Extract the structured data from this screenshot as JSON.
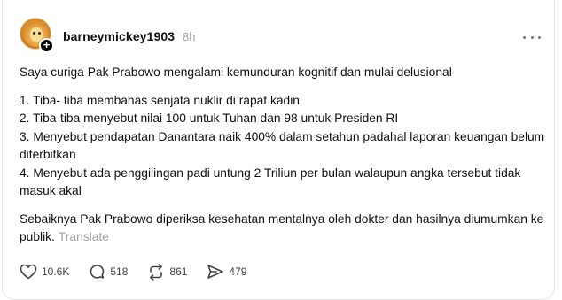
{
  "post": {
    "username": "barneymickey1903",
    "time": "8h",
    "paragraphs": [
      "Saya curiga Pak Prabowo mengalami kemunduran kognitif dan mulai delusional",
      "1. Tiba- tiba membahas senjata nuklir di rapat kadin",
      "2. Tiba-tiba menyebut nilai 100 untuk Tuhan dan 98 untuk Presiden RI",
      "3. Menyebut pendapatan Danantara naik 400% dalam setahun padahal laporan keuangan belum diterbitkan",
      "4. Menyebut ada penggilingan padi untung 2 Triliun per bulan walaupun angka tersebut tidak masuk akal",
      "Sebaiknya Pak Prabowo diperiksa kesehatan mentalnya oleh dokter dan hasilnya diumumkan ke publik."
    ],
    "translate_label": "Translate",
    "follow_symbol": "+"
  },
  "actions": {
    "likes": "10.6K",
    "replies": "518",
    "reposts": "861",
    "shares": "479"
  },
  "icons": {
    "like": "heart-icon",
    "reply": "comment-icon",
    "repost": "repost-icon",
    "share": "send-icon",
    "more": "more-icon"
  }
}
